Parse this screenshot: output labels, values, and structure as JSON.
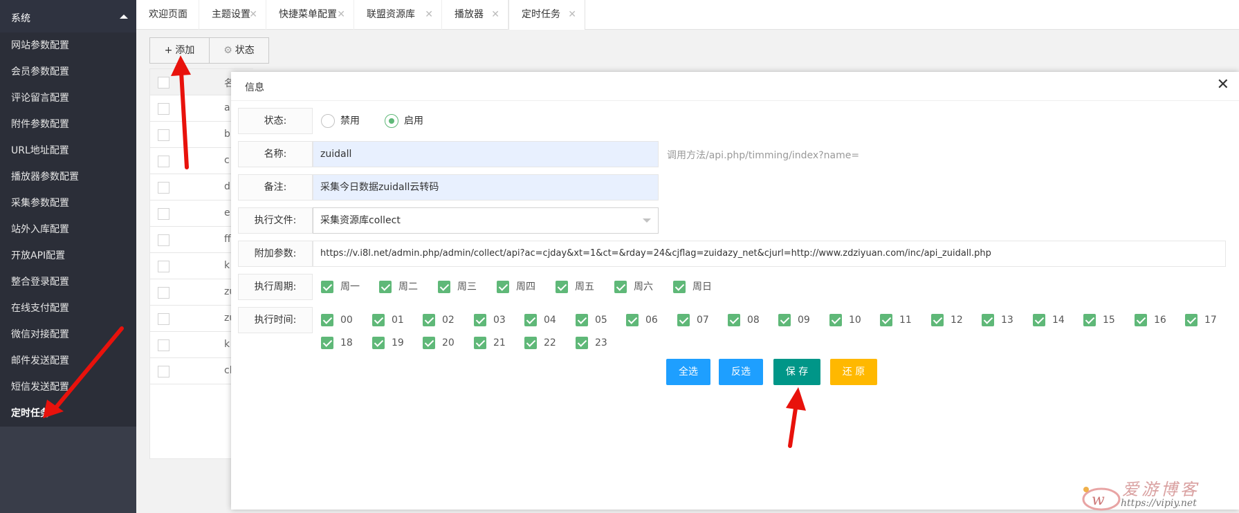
{
  "sidebar": {
    "section_title": "系统",
    "items": [
      {
        "label": "网站参数配置"
      },
      {
        "label": "会员参数配置"
      },
      {
        "label": "评论留言配置"
      },
      {
        "label": "附件参数配置"
      },
      {
        "label": "URL地址配置"
      },
      {
        "label": "播放器参数配置"
      },
      {
        "label": "采集参数配置"
      },
      {
        "label": "站外入库配置"
      },
      {
        "label": "开放API配置"
      },
      {
        "label": "整合登录配置"
      },
      {
        "label": "在线支付配置"
      },
      {
        "label": "微信对接配置"
      },
      {
        "label": "邮件发送配置"
      },
      {
        "label": "短信发送配置"
      },
      {
        "label": "定时任务"
      }
    ]
  },
  "tabs": [
    {
      "label": "欢迎页面"
    },
    {
      "label": "主题设置"
    },
    {
      "label": "快捷菜单配置"
    },
    {
      "label": "联盟资源库"
    },
    {
      "label": "播放器"
    },
    {
      "label": "定时任务"
    }
  ],
  "tab_close_glyph": "✕",
  "toolbar": {
    "add_label": "添加",
    "state_label": "状态"
  },
  "bg_table": {
    "head_text": "名",
    "row_texts": [
      "a",
      "b",
      "c",
      "d",
      "e",
      "ff",
      "k",
      "zu",
      "zu",
      "k",
      "cl"
    ]
  },
  "modal": {
    "title": "信息",
    "close_glyph": "✕",
    "status": {
      "label": "状态:",
      "options": [
        {
          "label": "禁用",
          "checked": false
        },
        {
          "label": "启用",
          "checked": true
        }
      ]
    },
    "name": {
      "label": "名称:",
      "value": "zuidall",
      "hint": "调用方法/api.php/timming/index?name="
    },
    "remark": {
      "label": "备注:",
      "value": "采集今日数据zuidall云转码"
    },
    "file": {
      "label": "执行文件:",
      "value": "采集资源库collect"
    },
    "params": {
      "label": "附加参数:",
      "value": "https://v.i8l.net/admin.php/admin/collect/api?ac=cjday&xt=1&ct=&rday=24&cjflag=zuidazy_net&cjurl=http://www.zdziyuan.com/inc/api_zuidall.php"
    },
    "weekdays": {
      "label": "执行周期:",
      "items": [
        "周一",
        "周二",
        "周三",
        "周四",
        "周五",
        "周六",
        "周日"
      ]
    },
    "hours": {
      "label": "执行时间:",
      "items": [
        "00",
        "01",
        "02",
        "03",
        "04",
        "05",
        "06",
        "07",
        "08",
        "09",
        "10",
        "11",
        "12",
        "13",
        "14",
        "15",
        "16",
        "17",
        "18",
        "19",
        "20",
        "21",
        "22",
        "23"
      ]
    },
    "buttons": {
      "select_all": "全选",
      "invert": "反选",
      "save": "保 存",
      "reset": "还 原"
    }
  },
  "watermark": {
    "title": "爱游博客",
    "url": "https://vipiy.net"
  },
  "colors": {
    "sidebar_bg": "#393d49",
    "check_green": "#5fb878",
    "btn_blue": "#1e9fff",
    "btn_teal": "#009688",
    "btn_yellow": "#ffb800",
    "arrow_red": "#e8120c"
  }
}
